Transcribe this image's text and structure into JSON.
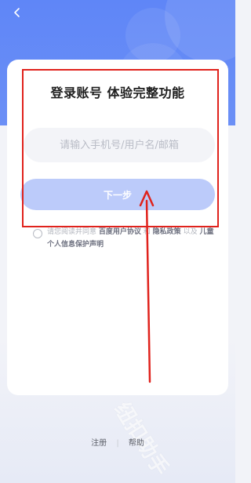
{
  "header": {
    "back_icon": "chevron-left-icon"
  },
  "login": {
    "title": "登录账号 体验完整功能",
    "account_placeholder": "请输入手机号/用户名/邮箱",
    "account_value": "",
    "next_label": "下一步"
  },
  "agreement": {
    "prefix": "请您阅读并同意",
    "user_agreement": "百度用户协议",
    "and": "和",
    "privacy_policy": "隐私政策",
    "and2": "以及",
    "child_privacy": "儿童个人信息保护声明",
    "checked": false
  },
  "footer": {
    "register": "注册",
    "separator": "|",
    "help": "帮助"
  },
  "watermark": "纽扣助手",
  "colors": {
    "accent": "#5f86f7",
    "button_disabled": "#bccbfa",
    "annotation": "#e0221c"
  }
}
